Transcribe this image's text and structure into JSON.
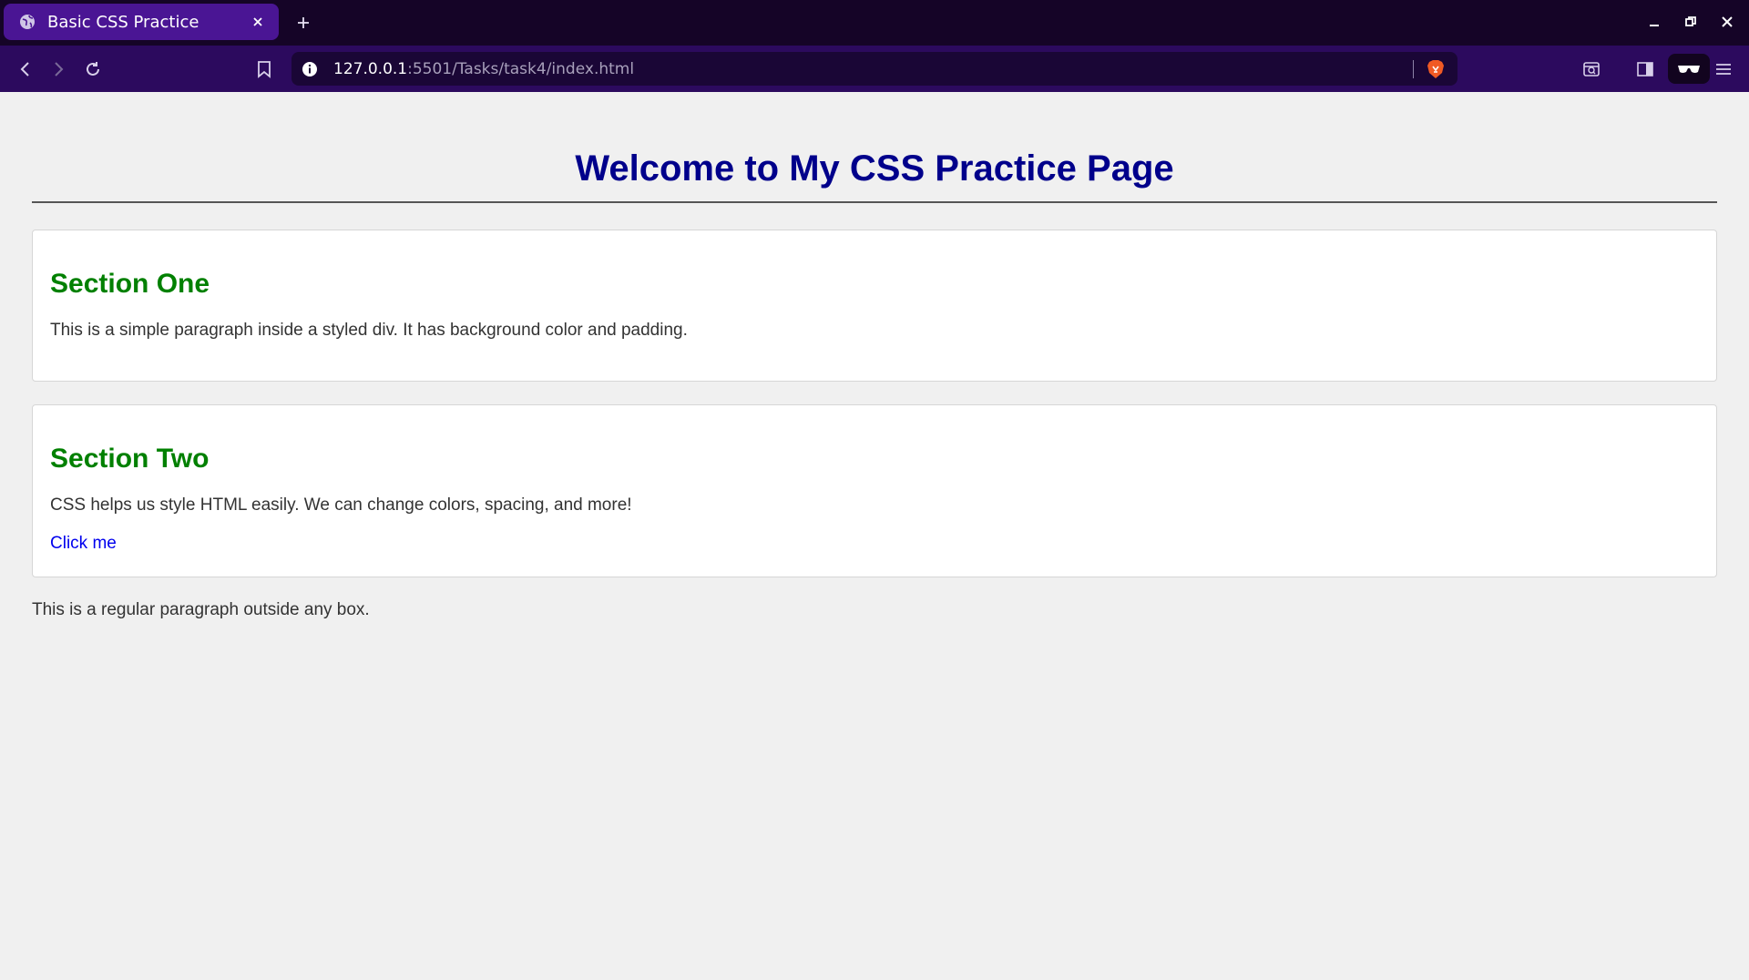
{
  "browser": {
    "tab": {
      "title": "Basic CSS Practice"
    },
    "url": {
      "host": "127.0.0.1",
      "rest": ":5501/Tasks/task4/index.html"
    },
    "colors": {
      "tabbar": "#150427",
      "toolbar": "#2c0a5e",
      "active_tab": "#4a1594",
      "urlbar": "#1a0636"
    }
  },
  "page": {
    "title": "Welcome to My CSS Practice Page",
    "sections": [
      {
        "heading": "Section One",
        "text": "This is a simple paragraph inside a styled div. It has background color and padding."
      },
      {
        "heading": "Section Two",
        "text": "CSS helps us style HTML easily. We can change colors, spacing, and more!",
        "link": "Click me"
      }
    ],
    "outside_text": "This is a regular paragraph outside any box.",
    "colors": {
      "title": "#00008b",
      "heading": "#008000",
      "link": "#0000ee",
      "background": "#f0f0f0"
    }
  }
}
